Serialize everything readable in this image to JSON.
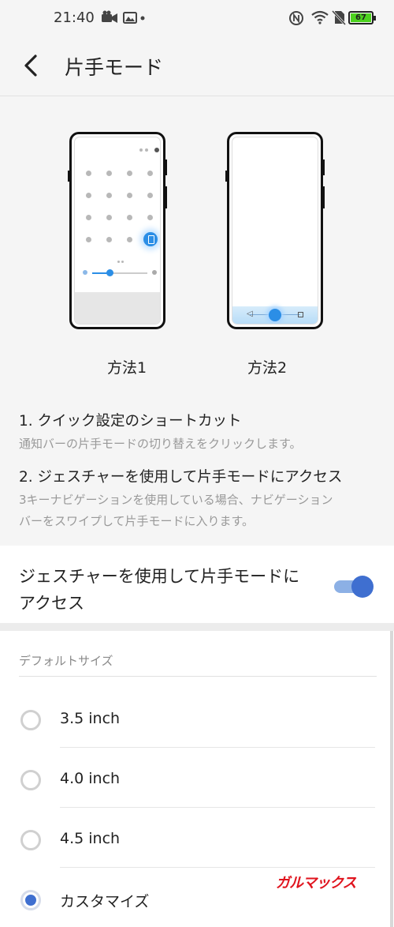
{
  "status_bar": {
    "time": "21:40",
    "battery_level": "67",
    "icons": [
      "video-camera-icon",
      "image-icon",
      "dot-icon",
      "nfc-icon",
      "wifi-icon",
      "no-sim-icon",
      "battery-icon"
    ]
  },
  "app_bar": {
    "back_icon": "chevron-left-icon",
    "title": "片手モード"
  },
  "illustrations": {
    "method1_label": "方法1",
    "method2_label": "方法2"
  },
  "instructions": {
    "item1_title": "1. クイック設定のショートカット",
    "item1_desc": "通知バーの片手モードの切り替えをクリックします。",
    "item2_title": "2. ジェスチャーを使用して片手モードにアクセス",
    "item2_desc_line1": "3キーナビゲーションを使用している場合、ナビゲーション",
    "item2_desc_line2": "バーをスワイプして片手モードに入ります。"
  },
  "gesture_toggle": {
    "label": "ジェスチャーを使用して片手モードにアクセス",
    "enabled": true,
    "accent": "#3f6fd0"
  },
  "default_size": {
    "section_title": "デフォルトサイズ",
    "options": [
      {
        "label": "3.5 inch",
        "selected": false
      },
      {
        "label": "4.0 inch",
        "selected": false
      },
      {
        "label": "4.5 inch",
        "selected": false
      },
      {
        "label": "カスタマイズ",
        "selected": true
      }
    ]
  },
  "watermark": "ガルマックス"
}
